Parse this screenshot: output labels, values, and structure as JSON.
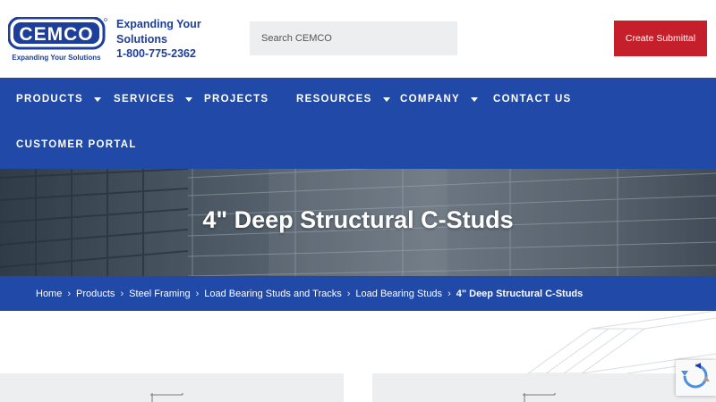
{
  "header": {
    "logo_text": "CEMCO",
    "logo_tagline": "Expanding Your Solutions",
    "tagline_line1": "Expanding Your",
    "tagline_line2": "Solutions",
    "phone": "1-800-775-2362",
    "search_placeholder": "Search CEMCO",
    "cta_label": "Create Submittal"
  },
  "nav": {
    "items": [
      {
        "label": "PRODUCTS",
        "has_dropdown": true
      },
      {
        "label": "SERVICES",
        "has_dropdown": true
      },
      {
        "label": "PROJECTS",
        "has_dropdown": false
      },
      {
        "label": "RESOURCES",
        "has_dropdown": true
      },
      {
        "label": "COMPANY",
        "has_dropdown": true
      },
      {
        "label": "CONTACT US",
        "has_dropdown": false
      },
      {
        "label": "CUSTOMER PORTAL",
        "has_dropdown": false
      }
    ]
  },
  "hero": {
    "title": "4\" Deep Structural C-Studs"
  },
  "breadcrumb": {
    "items": [
      "Home",
      "Products",
      "Steel Framing",
      "Load Bearing Studs and Tracks",
      "Load Bearing Studs"
    ],
    "current": "4\" Deep Structural C-Studs",
    "separator": "›"
  },
  "colors": {
    "brand_blue": "#2149a8",
    "cta_red": "#c41f2b",
    "logo_navy": "#1d3f9b"
  },
  "icons": {
    "dropdown": "caret-down-icon",
    "recaptcha": "recaptcha-icon"
  }
}
